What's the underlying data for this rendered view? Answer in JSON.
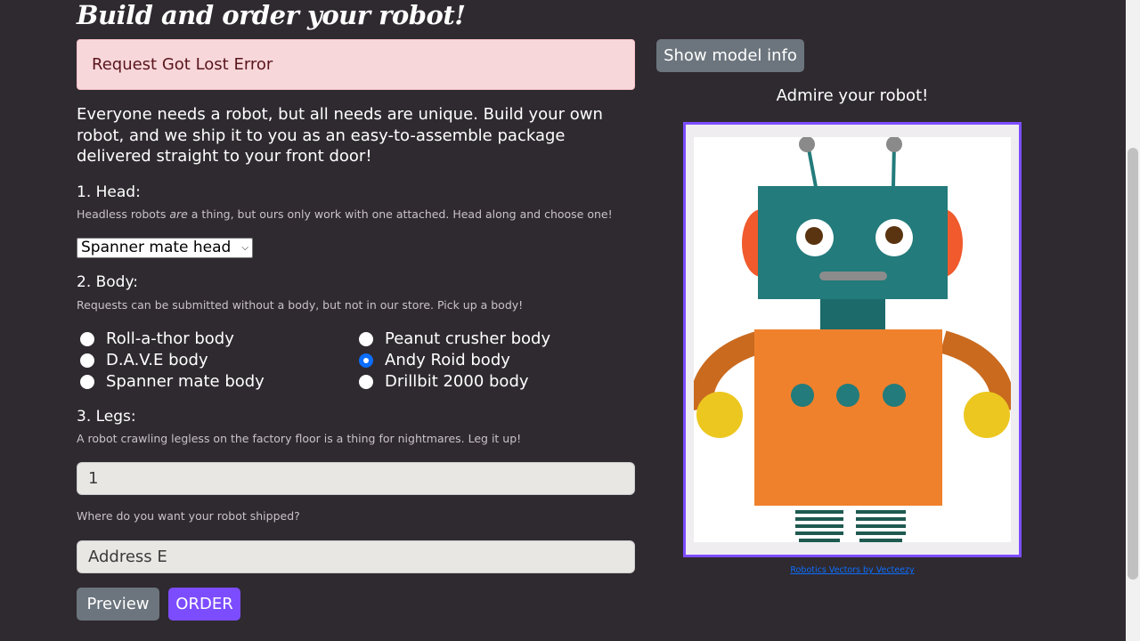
{
  "page": {
    "title": "Build and order your robot!"
  },
  "alert": {
    "text": "Request Got Lost Error"
  },
  "intro": "Everyone needs a robot, but all needs are unique. Build your own robot, and we ship it to you as an easy-to-assemble package delivered straight to your front door!",
  "head": {
    "label": "1. Head:",
    "help_prefix": "Headless robots ",
    "help_emphasis": "are",
    "help_suffix": " a thing, but ours only work with one attached. Head along and choose one!",
    "selected": "Spanner mate head"
  },
  "body": {
    "label": "2. Body:",
    "help": "Requests can be submitted without a body, but not in our store. Pick up a body!",
    "options": [
      {
        "label": "Roll-a-thor body",
        "checked": false
      },
      {
        "label": "Peanut crusher body",
        "checked": false
      },
      {
        "label": "D.A.V.E body",
        "checked": false
      },
      {
        "label": "Andy Roid body",
        "checked": true
      },
      {
        "label": "Spanner mate body",
        "checked": false
      },
      {
        "label": "Drillbit 2000 body",
        "checked": false
      }
    ]
  },
  "legs": {
    "label": "3. Legs:",
    "help": "A robot crawling legless on the factory floor is a thing for nightmares. Leg it up!",
    "value": "1"
  },
  "shipping": {
    "label": "Where do you want your robot shipped?",
    "value": "Address E"
  },
  "buttons": {
    "preview": "Preview",
    "order": "ORDER",
    "show_model_info": "Show model info"
  },
  "preview": {
    "heading": "Admire your robot!",
    "credit": "Robotics Vectors by Vecteezy"
  },
  "colors": {
    "background": "#2f2a30",
    "accent": "#7c4dff",
    "alert_bg": "#f8d7da",
    "robot_head": "#237b7b",
    "robot_body": "#f0812c"
  }
}
